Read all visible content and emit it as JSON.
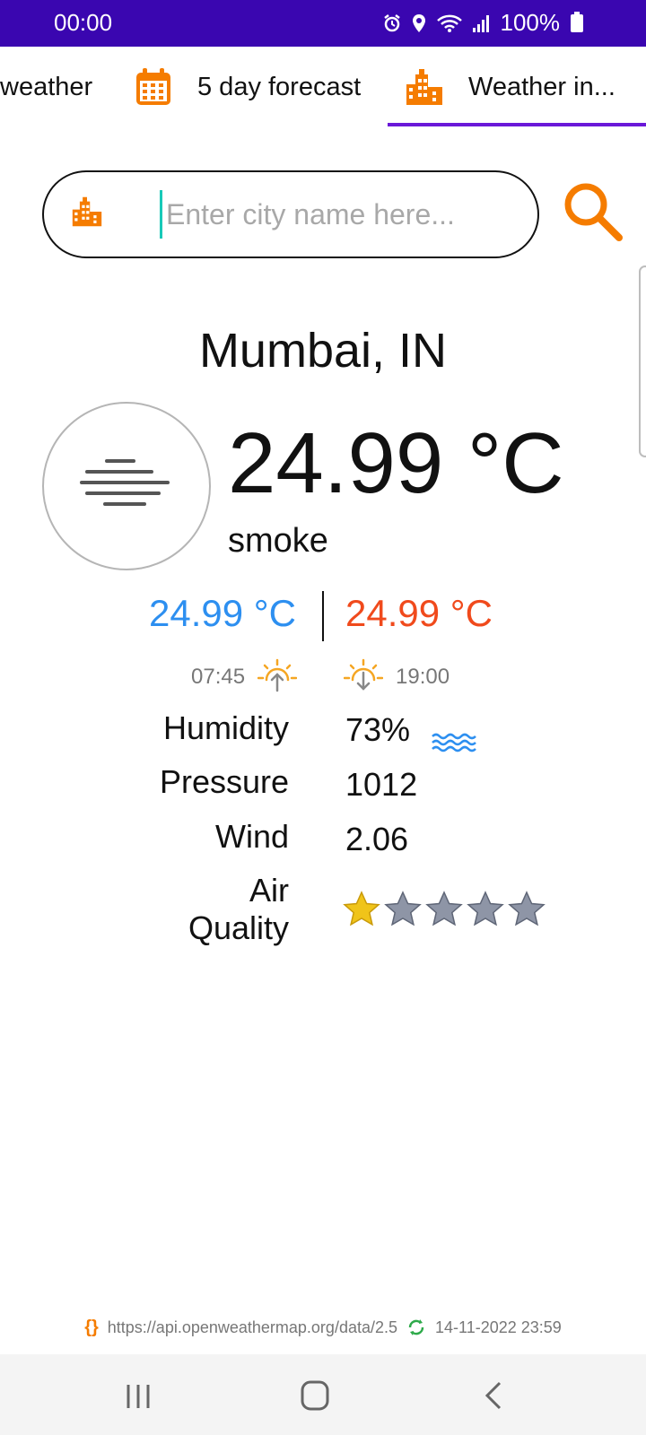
{
  "status_bar": {
    "time": "00:00",
    "battery": "100%"
  },
  "tabs": [
    {
      "label": "weather",
      "icon": "unknown"
    },
    {
      "label": "5 day forecast",
      "icon": "calendar-icon"
    },
    {
      "label": "Weather in...",
      "icon": "city-icon",
      "selected": true
    }
  ],
  "search": {
    "placeholder": "Enter city name here...",
    "value": ""
  },
  "weather": {
    "city": "Mumbai, IN",
    "temperature": "24.99 °C",
    "condition": "smoke",
    "min_temp": "24.99 °C",
    "max_temp": "24.99 °C",
    "sunrise": "07:45",
    "sunset": "19:00"
  },
  "stats": {
    "humidity_label": "Humidity",
    "humidity_value": "73%",
    "pressure_label": "Pressure",
    "pressure_value": "1012",
    "wind_label": "Wind",
    "wind_value": "2.06",
    "air_quality_label": "Air Quality",
    "air_quality_rating": 1,
    "air_quality_max": 5
  },
  "footer": {
    "api_url": "https://api.openweathermap.org/data/2.5",
    "updated": "14-11-2022 23:59"
  },
  "colors": {
    "status_bar": "#3a06b0",
    "tab_accent": "#6a18d8",
    "orange": "#f57c00",
    "min_temp": "#2d8ff0",
    "max_temp": "#f04a1c",
    "cursor": "#18c9b8"
  }
}
